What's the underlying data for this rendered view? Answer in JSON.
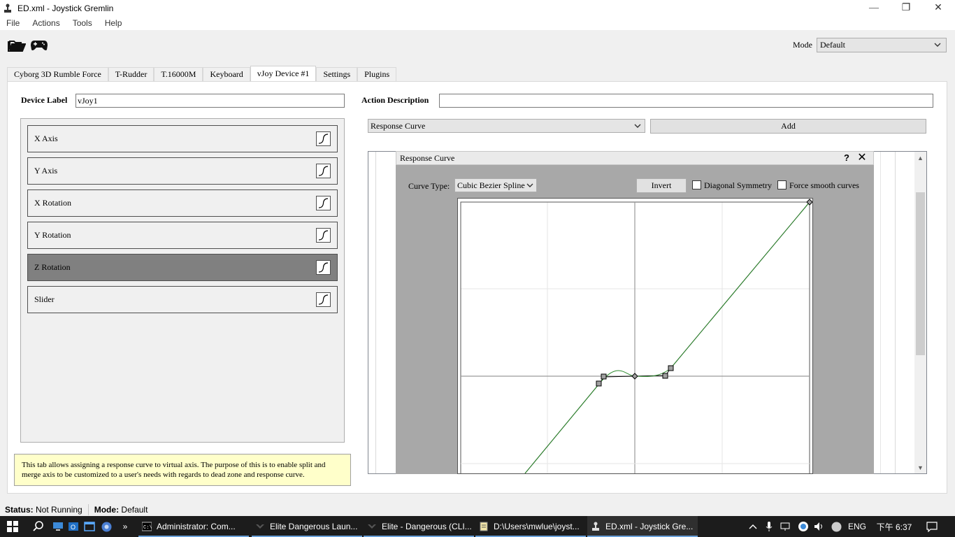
{
  "window": {
    "title": "ED.xml - Joystick Gremlin",
    "controls": {
      "minimize": "—",
      "restore": "❐",
      "close": "✕"
    }
  },
  "menu": [
    "File",
    "Actions",
    "Tools",
    "Help"
  ],
  "toolbar": {
    "open_icon": "folder-open-icon",
    "device_icon": "gamepad-icon",
    "mode_label": "Mode",
    "mode_value": "Default"
  },
  "tabs": [
    {
      "label": "Cyborg 3D Rumble Force",
      "active": false
    },
    {
      "label": "T-Rudder",
      "active": false
    },
    {
      "label": "T.16000M",
      "active": false
    },
    {
      "label": "Keyboard",
      "active": false
    },
    {
      "label": "vJoy Device #1",
      "active": true
    },
    {
      "label": "Settings",
      "active": false
    },
    {
      "label": "Plugins",
      "active": false
    }
  ],
  "device": {
    "label_text": "Device Label",
    "label_value": "vJoy1"
  },
  "action": {
    "description_label": "Action Description",
    "description_value": "",
    "selected_action": "Response Curve",
    "add_label": "Add"
  },
  "axes": [
    {
      "label": "X Axis",
      "selected": false
    },
    {
      "label": "Y Axis",
      "selected": false
    },
    {
      "label": "X Rotation",
      "selected": false
    },
    {
      "label": "Y Rotation",
      "selected": false
    },
    {
      "label": "Z Rotation",
      "selected": true
    },
    {
      "label": "Slider",
      "selected": false
    }
  ],
  "info_text": "This tab allows assigning a response curve to virtual axis. The purpose of this is to enable split and merge axis to be customized to a user's needs with regards to dead zone and response curve.",
  "response_curve": {
    "title": "Response Curve",
    "help": "?",
    "close": "✕",
    "curve_type_label": "Curve Type:",
    "curve_type_value": "Cubic Bezier Spline",
    "invert_label": "Invert",
    "diagonal_symmetry_label": "Diagonal Symmetry",
    "diagonal_symmetry_checked": false,
    "force_smooth_label": "Force smooth curves",
    "force_smooth_checked": false
  },
  "status": {
    "status_label": "Status:",
    "status_value": "Not Running",
    "mode_label": "Mode:",
    "mode_value": "Default"
  },
  "taskbar": {
    "items": [
      {
        "label": "Administrator: Com..."
      },
      {
        "label": "Elite Dangerous Laun..."
      },
      {
        "label": "Elite - Dangerous (CLI..."
      },
      {
        "label": "D:\\Users\\mwlue\\joyst..."
      },
      {
        "label": "ED.xml - Joystick Gre..."
      }
    ],
    "language": "ENG",
    "clock": "下午 6:37"
  }
}
